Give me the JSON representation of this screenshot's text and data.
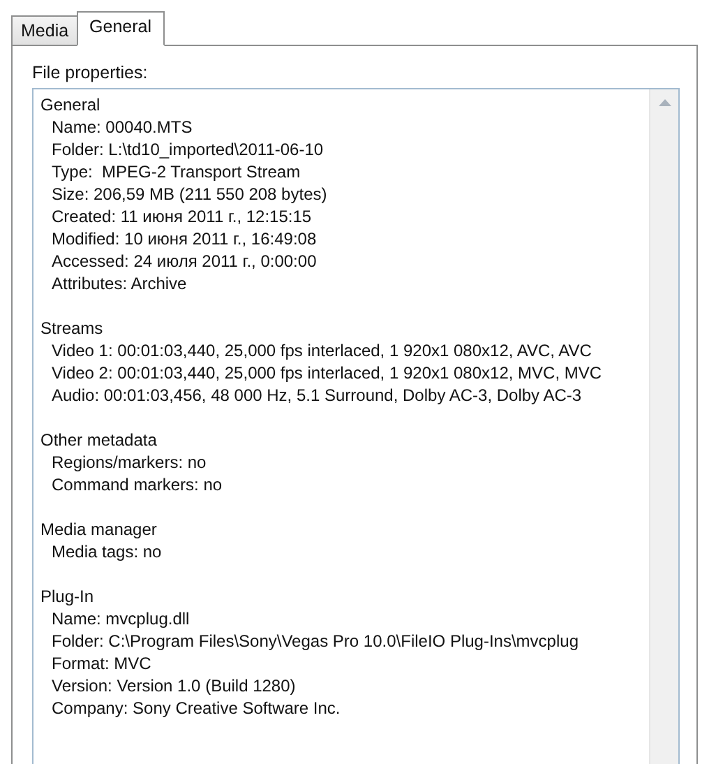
{
  "tabs": [
    {
      "label": "Media",
      "selected": false
    },
    {
      "label": "General",
      "selected": true
    }
  ],
  "file_properties": {
    "label": "File properties:",
    "sections": [
      {
        "title": "General",
        "lines": [
          "Name: 00040.MTS",
          "Folder: L:\\td10_imported\\2011-06-10",
          "Type:  MPEG-2 Transport Stream",
          "Size: 206,59 MB (211 550 208 bytes)",
          "Created: 11 июня 2011 г., 12:15:15",
          "Modified: 10 июня 2011 г., 16:49:08",
          "Accessed: 24 июля 2011 г., 0:00:00",
          "Attributes: Archive"
        ]
      },
      {
        "title": "Streams",
        "lines": [
          "Video 1: 00:01:03,440, 25,000 fps interlaced, 1 920x1 080x12, AVC, AVC",
          "Video 2: 00:01:03,440, 25,000 fps interlaced, 1 920x1 080x12, MVC, MVC",
          "Audio: 00:01:03,456, 48 000 Hz, 5.1 Surround, Dolby AC-3, Dolby AC-3"
        ]
      },
      {
        "title": "Other metadata",
        "lines": [
          "Regions/markers: no",
          "Command markers: no"
        ]
      },
      {
        "title": "Media manager",
        "lines": [
          "Media tags: no"
        ]
      },
      {
        "title": "Plug-In",
        "lines": [
          "Name: mvcplug.dll",
          "Folder: C:\\Program Files\\Sony\\Vegas Pro 10.0\\FileIO Plug-Ins\\mvcplug",
          "Format: MVC",
          "Version: Version 1.0 (Build 1280)",
          "Company: Sony Creative Software Inc."
        ]
      }
    ]
  }
}
